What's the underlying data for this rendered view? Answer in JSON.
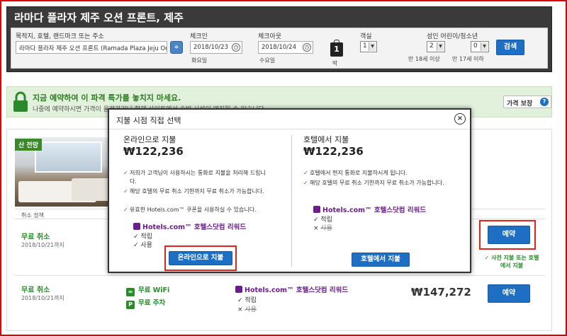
{
  "search": {
    "title": "라마다 플라자 제주 오션 프론트, 제주",
    "destination_label": "목적지, 호텔, 랜드마크 또는 주소",
    "destination_value": "라마다 플라자 제주 오션 프론트 (Ramada Plaza Jeju Oce",
    "checkin_label": "체크인",
    "checkin_value": "2018/10/23",
    "checkin_day": "화요일",
    "checkout_label": "체크아웃",
    "checkout_value": "2018/10/24",
    "checkout_day": "수요일",
    "nights": "1",
    "nights_unit": "박",
    "rooms_label": "객실",
    "rooms_value": "1",
    "guests_label": "성인 어린이/청소년",
    "adults_value": "2",
    "children_value": "0",
    "adults_note": "만 18세 이상",
    "children_note": "만 17세 이하",
    "search_button": "검색"
  },
  "promo": {
    "headline": "지금 예약하여 이 파격 특가를 놓치지 마세요.",
    "text": "나중에 예약하시면 가격이 올라가거나 현재 사이트에서 숙박 시설이 매진될 수 있습니다.",
    "price_guarantee": "가격 보장",
    "help_icon_text": "?"
  },
  "room": {
    "tag": "산 전망",
    "policy_header": "취소 정책",
    "row1": {
      "free_cancel": "무료 취소",
      "until": "2018/10/21까지",
      "book": "예약",
      "pay_note": "✓ 사전 지불 또는 호텔에서 지불"
    },
    "row2": {
      "free_cancel": "무료 취소",
      "until": "2018/10/21까지",
      "wifi": "무료 WiFi",
      "parking": "무료 주차",
      "rewards": "Hotels.com™ 호텔스닷컴 리워드",
      "earn": "적립",
      "use": "사용",
      "price": "₩147,272",
      "book": "예약"
    }
  },
  "modal": {
    "title": "지불 시점 직접 선택",
    "close": "×",
    "online": {
      "heading": "온라인으로 지불",
      "price": "₩122,236",
      "bullets": [
        "저희가 고객님이 사용하시는 통화로 지불을 처리해 드립니다.",
        "해당 호텔의 무료 취소 기한까지 무료 취소가 가능합니다.",
        "유효한 Hotels.com™ 쿠폰을 사용하실 수 있습니다."
      ],
      "rewards": "Hotels.com™ 호텔스닷컴 리워드",
      "earn": "적립",
      "use": "사용",
      "button": "온라인으로 지불"
    },
    "hotel": {
      "heading": "호텔에서 지불",
      "price": "₩122,236",
      "bullets": [
        "호텔에서 현지 통화로 지불하시게 됩니다.",
        "해당 호텔의 무료 취소 기한까지 무료 취소가 가능합니다."
      ],
      "rewards": "Hotels.com™ 호텔스닷컴 리워드",
      "earn": "적립",
      "use": "사용",
      "button": "호텔에서 지불"
    }
  }
}
